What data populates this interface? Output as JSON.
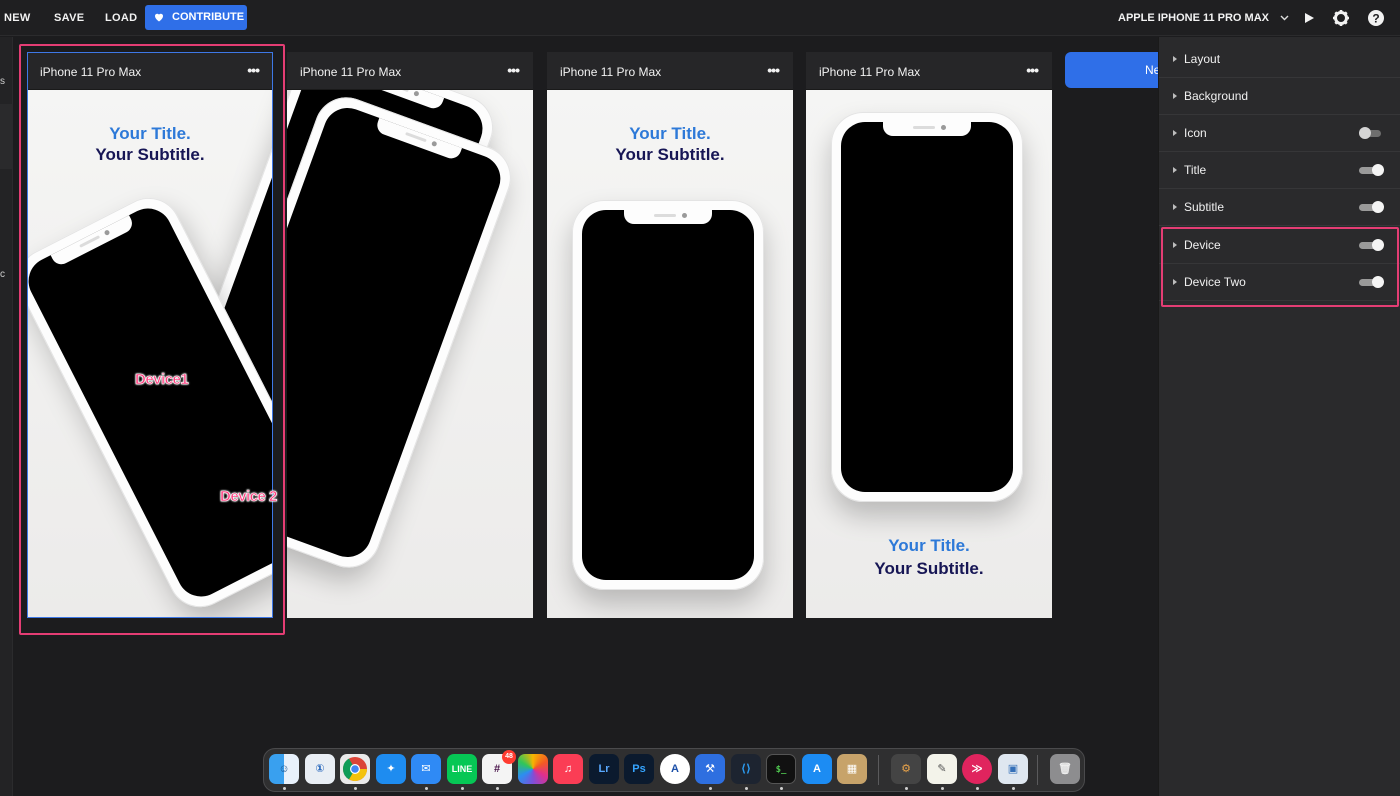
{
  "toolbar": {
    "new_label": "NEW",
    "save_label": "SAVE",
    "load_label": "LOAD",
    "contribute_label": "CONTRIBUTE",
    "device_selector": "APPLE IPHONE 11 PRO MAX"
  },
  "left_strip": {
    "chars": [
      "s",
      "c"
    ]
  },
  "cards": [
    {
      "title": "iPhone 11 Pro Max",
      "more": "•••",
      "heading": "Your Title.",
      "subheading": "Your Subtitle."
    },
    {
      "title": "iPhone 11 Pro Max",
      "more": "•••"
    },
    {
      "title": "iPhone 11 Pro Max",
      "more": "•••",
      "heading": "Your Title.",
      "subheading": "Your Subtitle."
    },
    {
      "title": "iPhone 11 Pro Max",
      "more": "•••",
      "heading": "Your Title.",
      "subheading": "Your Subtitle."
    }
  ],
  "annotations": {
    "device1": "Device1",
    "device2": "Device 2"
  },
  "next_button_partial": "Ne",
  "panel": {
    "rows": [
      {
        "label": "Layout",
        "toggle": null
      },
      {
        "label": "Background",
        "toggle": null
      },
      {
        "label": "Icon",
        "toggle": "off"
      },
      {
        "label": "Title",
        "toggle": "on"
      },
      {
        "label": "Subtitle",
        "toggle": "on"
      },
      {
        "label": "Device",
        "toggle": "on"
      },
      {
        "label": "Device Two",
        "toggle": "on"
      }
    ]
  },
  "dock": {
    "slack_badge": "48",
    "apps": [
      "Finder",
      "1Password",
      "Chrome",
      "Safari",
      "Mail",
      "LINE",
      "Slack",
      "Photos",
      "Music",
      "Lr",
      "Ps",
      "Vectornator",
      "Xcode",
      "VS Code",
      "Terminal",
      "App Store",
      "Archive",
      "Automator",
      "TextEdit",
      "Pinterest",
      "Preview",
      "Trash"
    ]
  },
  "colors": {
    "accent": "#2f6fe8",
    "highlight": "#e43d74",
    "title_blue": "#2d79d8",
    "subtitle_navy": "#171655"
  }
}
